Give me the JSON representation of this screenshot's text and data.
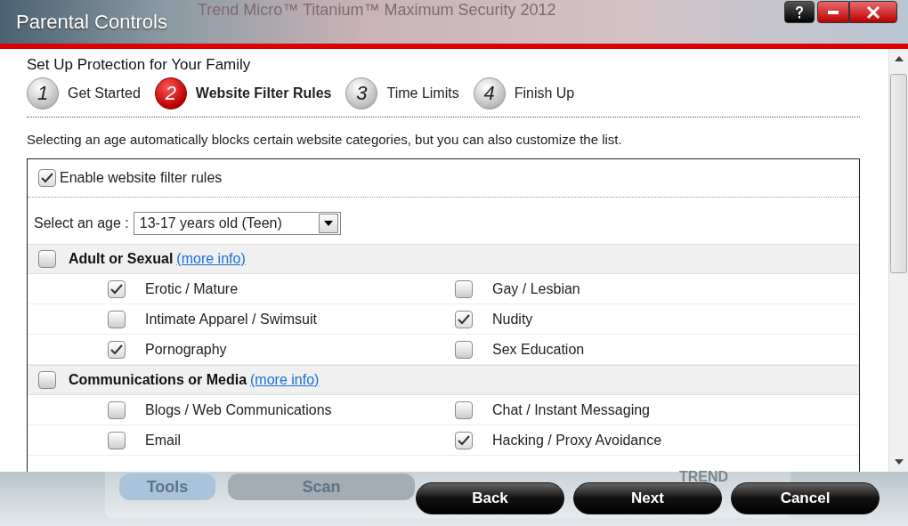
{
  "window": {
    "title": "Parental Controls",
    "background_title": "Trend Micro™ Titanium™ Maximum Security  2012"
  },
  "background_app": {
    "buttons": [
      "Tools",
      "Scan"
    ],
    "logo": "TREND"
  },
  "heading": "Set Up Protection for Your Family",
  "steps": [
    {
      "number": "1",
      "label": "Get Started",
      "selected": false
    },
    {
      "number": "2",
      "label": "Website Filter Rules",
      "selected": true
    },
    {
      "number": "3",
      "label": "Time Limits",
      "selected": false
    },
    {
      "number": "4",
      "label": "Finish Up",
      "selected": false
    }
  ],
  "description": "Selecting an age automatically blocks certain website categories, but you can also customize the list.",
  "enable": {
    "label": "Enable website filter rules",
    "checked": true
  },
  "age": {
    "label": "Select an age :",
    "value": "13-17 years old (Teen)"
  },
  "categories": [
    {
      "name": "Adult or Sexual",
      "link": "(more info)",
      "checked": false,
      "items": [
        {
          "label": "Erotic / Mature",
          "checked": true
        },
        {
          "label": "Gay / Lesbian",
          "checked": false
        },
        {
          "label": "Intimate Apparel / Swimsuit",
          "checked": false
        },
        {
          "label": "Nudity",
          "checked": true
        },
        {
          "label": "Pornography",
          "checked": true
        },
        {
          "label": "Sex Education",
          "checked": false
        }
      ]
    },
    {
      "name": "Communications or Media",
      "link": "(more info)",
      "checked": false,
      "items": [
        {
          "label": "Blogs / Web Communications",
          "checked": false
        },
        {
          "label": "Chat / Instant Messaging",
          "checked": false
        },
        {
          "label": "Email",
          "checked": false
        },
        {
          "label": "Hacking / Proxy Avoidance",
          "checked": true
        }
      ]
    }
  ],
  "buttons": [
    "Back",
    "Next",
    "Cancel"
  ]
}
